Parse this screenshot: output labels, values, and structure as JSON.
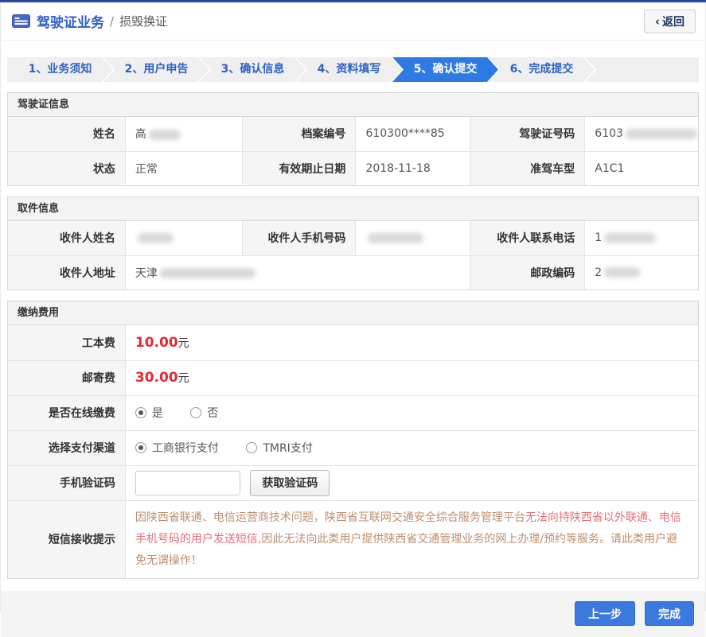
{
  "header": {
    "app_title": "驾驶证业务",
    "separator": "/",
    "page_title": "损毁换证",
    "back_chevron": "‹",
    "back_label": "返回"
  },
  "wizard": {
    "steps": [
      {
        "label": "1、业务须知",
        "active": false
      },
      {
        "label": "2、用户申告",
        "active": false
      },
      {
        "label": "3、确认信息",
        "active": false
      },
      {
        "label": "4、资料填写",
        "active": false
      },
      {
        "label": "5、确认提交",
        "active": true
      },
      {
        "label": "6、完成提交",
        "active": false
      }
    ]
  },
  "sections": {
    "license": {
      "title": "驾驶证信息",
      "rows": [
        [
          {
            "label": "姓名",
            "value": "高"
          },
          {
            "label": "档案编号",
            "value": "610300****85"
          },
          {
            "label": "驾驶证号码",
            "value": "6103"
          }
        ],
        [
          {
            "label": "状态",
            "value": "正常"
          },
          {
            "label": "有效期止日期",
            "value": "2018-11-18"
          },
          {
            "label": "准驾车型",
            "value": "A1C1"
          }
        ]
      ]
    },
    "pickup": {
      "title": "取件信息",
      "rows": [
        [
          {
            "label": "收件人姓名",
            "value": ""
          },
          {
            "label": "收件人手机号码",
            "value": ""
          },
          {
            "label": "收件人联系电话",
            "value": "1"
          }
        ],
        [
          {
            "label": "收件人地址",
            "value": "天津"
          },
          {
            "label": "邮政编码",
            "value": "2"
          }
        ]
      ]
    },
    "payment": {
      "title": "缴纳费用",
      "fees": [
        {
          "label": "工本费",
          "amount": "10.00",
          "unit": "元"
        },
        {
          "label": "邮寄费",
          "amount": "30.00",
          "unit": "元"
        }
      ],
      "online": {
        "label": "是否在线缴费",
        "options": [
          {
            "label": "是",
            "selected": true
          },
          {
            "label": "否",
            "selected": false
          }
        ]
      },
      "channel": {
        "label": "选择支付渠道",
        "options": [
          {
            "label": "工商银行支付",
            "selected": true
          },
          {
            "label": "TMRI支付",
            "selected": false
          }
        ]
      },
      "captcha": {
        "label": "手机验证码",
        "input_value": "",
        "button_label": "获取验证码"
      },
      "notice": {
        "label": "短信接收提示",
        "segments": [
          {
            "tone": "muted",
            "text": "因陕西省联通、电信运营商技术问题，陕西省互联网交通安全综合服务管理平台"
          },
          {
            "tone": "bright",
            "text": "无法向持陕西省以外联通、电信手机号码的用户发送短信,"
          },
          {
            "tone": "muted",
            "text": "因此无法向此类用户提供陕西省交通管理业务的网上办理/预约等服务。请此类用户避免无谓操作！"
          }
        ]
      }
    }
  },
  "footer": {
    "prev_label": "上一步",
    "finish_label": "完成"
  },
  "colors": {
    "top_bar": "#2a46a8",
    "accent_blue": "#2e5fc9",
    "step_active_bg": "#2e7ae4",
    "fee_red": "#e8282f",
    "notice_muted": "#bd8e6e",
    "notice_bright": "#e96e76",
    "button_blue": "#3b79de"
  }
}
